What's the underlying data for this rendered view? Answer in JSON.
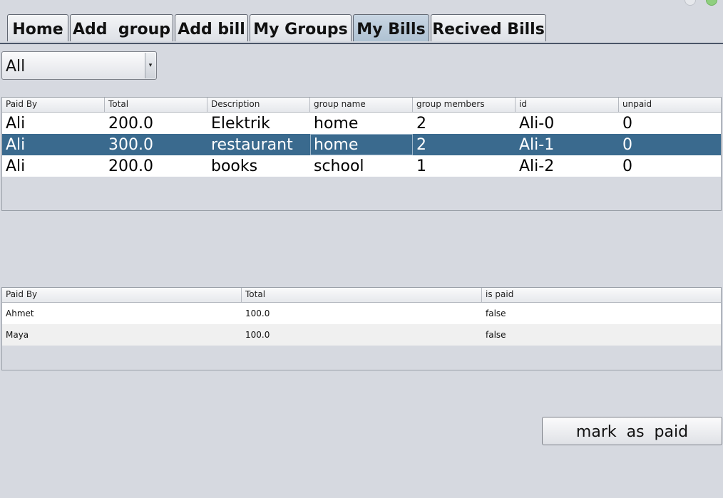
{
  "window": {
    "controls": [
      {
        "icon": "minimize-icon"
      },
      {
        "icon": "close-icon",
        "color": "#8fcf7f"
      }
    ]
  },
  "tabs": [
    {
      "label": "Home",
      "active": false
    },
    {
      "label": "Add  group",
      "active": false
    },
    {
      "label": "Add bill",
      "active": false
    },
    {
      "label": "My Groups",
      "active": false
    },
    {
      "label": "My Bills",
      "active": true
    },
    {
      "label": "Recived Bills",
      "active": false
    }
  ],
  "filter": {
    "selected": "All",
    "arrow_icon": "chevron-down-icon",
    "arrow_glyph": "▾"
  },
  "bills_table": {
    "columns": [
      "Paid By",
      "Total",
      "Description",
      "group name",
      "group members",
      "id",
      "unpaid"
    ],
    "rows": [
      [
        "Ali",
        "200.0",
        "Elektrik",
        "home",
        "2",
        "Ali-0",
        "0"
      ],
      [
        "Ali",
        "300.0",
        "restaurant",
        "home",
        "2",
        "Ali-1",
        "0"
      ],
      [
        "Ali",
        "200.0",
        "books",
        "school",
        "1",
        "Ali-2",
        "0"
      ]
    ],
    "selected_row": 1,
    "selection_color": "#3a6a8e"
  },
  "members_table": {
    "columns": [
      "Paid By",
      "Total",
      "is paid"
    ],
    "rows": [
      [
        "Ahmet",
        "100.0",
        "false"
      ],
      [
        "Maya",
        "100.0",
        "false"
      ]
    ]
  },
  "actions": {
    "mark_paid_label": "mark  as  paid"
  }
}
